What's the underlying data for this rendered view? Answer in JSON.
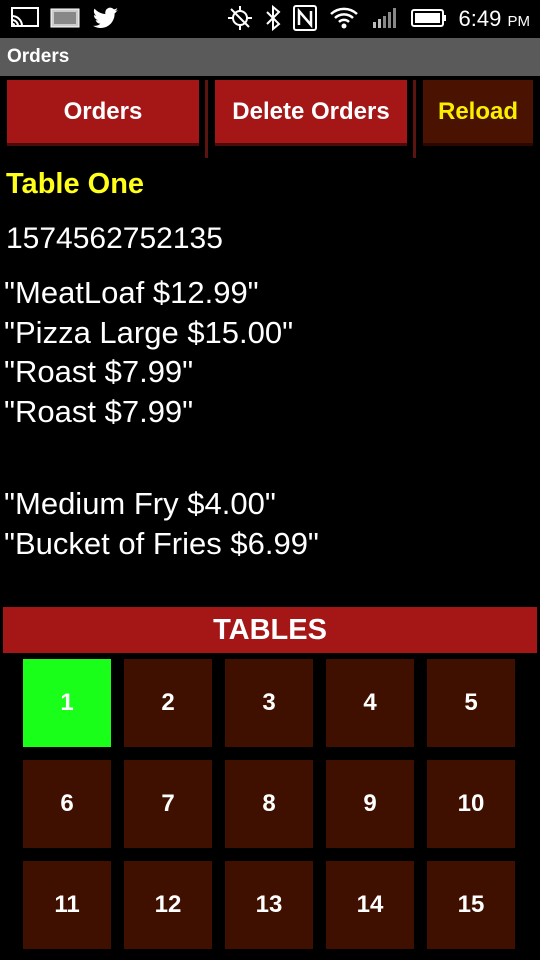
{
  "status_bar": {
    "left_icons": [
      "screencast-icon",
      "gallery-icon",
      "twitter-icon"
    ],
    "right_icons": [
      "gps-off-icon",
      "bluetooth-icon",
      "nfc-icon",
      "wifi-icon",
      "signal-icon",
      "battery-icon"
    ],
    "time": "6:49",
    "ampm": "PM"
  },
  "action_bar": {
    "title": "Orders"
  },
  "buttons": {
    "orders": "Orders",
    "delete_orders": "Delete Orders",
    "reload": "Reload"
  },
  "order": {
    "table_name": "Table One",
    "order_id": "1574562752135",
    "items_group1": [
      "\"MeatLoaf $12.99\"",
      "\"Pizza Large $15.00\"",
      "\"Roast $7.99\"",
      "\"Roast $7.99\""
    ],
    "items_group2": [
      "\"Medium Fry $4.00\"",
      "\"Bucket of Fries $6.99\""
    ]
  },
  "tables": {
    "header": "TABLES",
    "selected": "1",
    "tiles": [
      "1",
      "2",
      "3",
      "4",
      "5",
      "6",
      "7",
      "8",
      "9",
      "10",
      "11",
      "12",
      "13",
      "14",
      "15"
    ]
  },
  "colors": {
    "accent_red": "#a51616",
    "tile_brown": "#3f1000",
    "selected_green": "#19ff19",
    "highlight_yellow": "#ffff1a"
  }
}
